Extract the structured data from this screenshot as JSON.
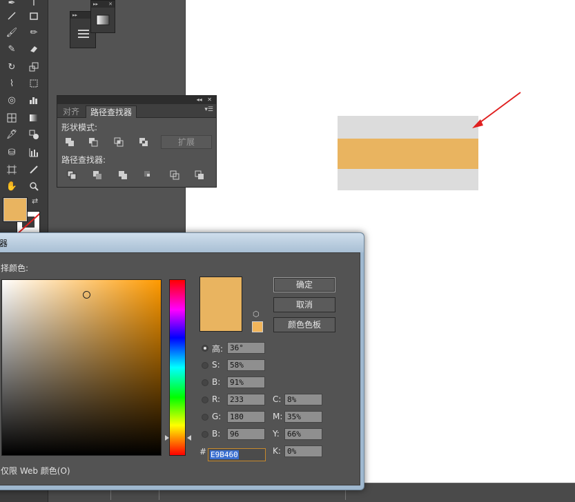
{
  "pathfinder_panel": {
    "tab_align": "对齐",
    "tab_pathfinder": "路径查找器",
    "shape_modes_label": "形状模式:",
    "expand_button": "扩展",
    "pathfinders_label": "路径查找器:"
  },
  "color_picker": {
    "title": "器",
    "select_color_label": "择颜色:",
    "ok_button": "确定",
    "cancel_button": "取消",
    "swatches_button": "颜色色板",
    "hsb": [
      {
        "label": "高:",
        "value": "36°",
        "checked": true
      },
      {
        "label": "S:",
        "value": "58%",
        "checked": false
      },
      {
        "label": "B:",
        "value": "91%",
        "checked": false
      }
    ],
    "rgb": [
      {
        "label": "R:",
        "value": "233"
      },
      {
        "label": "G:",
        "value": "180"
      },
      {
        "label": "B:",
        "value": "96"
      }
    ],
    "cmyk": [
      {
        "label": "C:",
        "value": "8%"
      },
      {
        "label": "M:",
        "value": "35%"
      },
      {
        "label": "Y:",
        "value": "66%"
      },
      {
        "label": "K:",
        "value": "0%"
      }
    ],
    "hex_label": "#",
    "hex_value": "E9B460",
    "web_only_label": "仅限 Web 颜色(O)"
  },
  "colors": {
    "current_fill": "#e9b460",
    "artwork_gray": "#dcdcdc",
    "annotation_arrow": "#e02020"
  }
}
